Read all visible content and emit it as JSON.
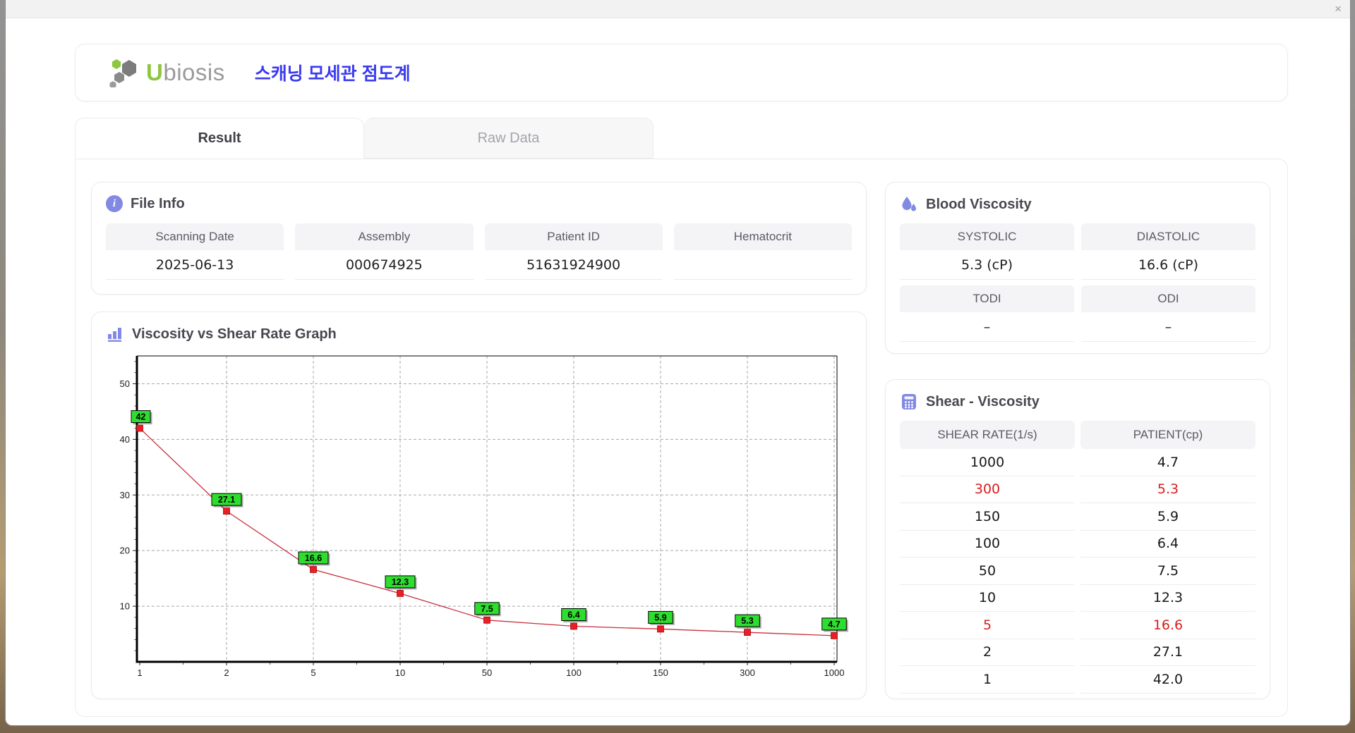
{
  "window": {
    "close_label": "×"
  },
  "header": {
    "brand_u": "U",
    "brand_rest": "biosis",
    "title_ko": "스캐닝 모세관 점도계"
  },
  "tabs": [
    {
      "label": "Result",
      "active": true
    },
    {
      "label": "Raw Data",
      "active": false
    }
  ],
  "file_info": {
    "title": "File Info",
    "fields": [
      {
        "label": "Scanning Date",
        "value": "2025-06-13"
      },
      {
        "label": "Assembly",
        "value": "000674925"
      },
      {
        "label": "Patient ID",
        "value": "51631924900"
      },
      {
        "label": "Hematocrit",
        "value": ""
      }
    ]
  },
  "graph": {
    "title": "Viscosity vs Shear Rate Graph"
  },
  "chart_data": {
    "type": "line",
    "title": "Viscosity vs Shear Rate Graph",
    "categories": [
      1,
      2,
      5,
      10,
      50,
      100,
      150,
      300,
      1000
    ],
    "values": [
      42,
      27.1,
      16.6,
      12.3,
      7.5,
      6.4,
      5.9,
      5.3,
      4.7
    ],
    "point_labels": [
      "42",
      "27.1",
      "16.6",
      "12.3",
      "7.5",
      "6.4",
      "5.9",
      "5.3",
      "4.7"
    ],
    "xlabel": "",
    "ylabel": "",
    "x_scale": "categorical-even",
    "ylim": [
      0,
      55
    ],
    "yticks": [
      10,
      20,
      30,
      40,
      50
    ],
    "grid": "dashed-gray",
    "legend": "none",
    "series_color": "#c9303e",
    "marker_color": "#ee1c25",
    "label_bg": "#2ede2e"
  },
  "blood_viscosity": {
    "title": "Blood Viscosity",
    "cells": [
      {
        "label": "SYSTOLIC",
        "value": "5.3 (cP)"
      },
      {
        "label": "DIASTOLIC",
        "value": "16.6 (cP)"
      },
      {
        "label": "TODI",
        "value": "–"
      },
      {
        "label": "ODI",
        "value": "–"
      }
    ]
  },
  "shear_table": {
    "title": "Shear - Viscosity",
    "columns": [
      "SHEAR RATE(1/s)",
      "PATIENT(cp)"
    ],
    "rows": [
      {
        "shear": "1000",
        "patient": "4.7",
        "highlight": false
      },
      {
        "shear": "300",
        "patient": "5.3",
        "highlight": true
      },
      {
        "shear": "150",
        "patient": "5.9",
        "highlight": false
      },
      {
        "shear": "100",
        "patient": "6.4",
        "highlight": false
      },
      {
        "shear": "50",
        "patient": "7.5",
        "highlight": false
      },
      {
        "shear": "10",
        "patient": "12.3",
        "highlight": false
      },
      {
        "shear": "5",
        "patient": "16.6",
        "highlight": true
      },
      {
        "shear": "2",
        "patient": "27.1",
        "highlight": false
      },
      {
        "shear": "1",
        "patient": "42.0",
        "highlight": false
      }
    ]
  },
  "colors": {
    "accent": "#8289e4",
    "brand_green": "#8dc63f",
    "brand_gray": "#9a9a9a",
    "title_blue": "#3a3af0",
    "highlight_red": "#d81e1e",
    "chart_line": "#c9303e",
    "chart_marker": "#ee1c25",
    "chart_label_green": "#2ede2e"
  }
}
